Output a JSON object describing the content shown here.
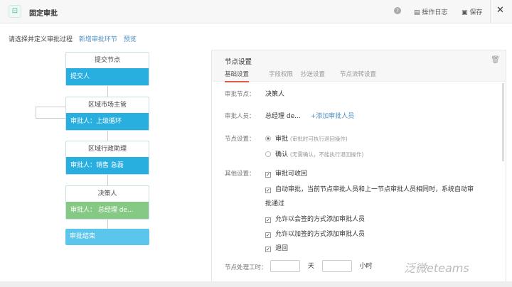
{
  "header": {
    "title": "固定审批",
    "help_icon": "question-icon",
    "log_label": "操作日志",
    "save_label": "保存"
  },
  "intro": {
    "text": "请选择并定义审批过程",
    "add_link": "新增审批环节",
    "preview_link": "预览"
  },
  "flow": {
    "nodes": [
      {
        "title": "提交节点",
        "body": "提交人",
        "color": "#29aee0"
      },
      {
        "title": "区域市场主管",
        "body": "审批人：上级循环",
        "color": "#29aee0"
      },
      {
        "title": "区域行政助理",
        "body": "审批人：销售 急磊",
        "color": "#29aee0"
      },
      {
        "title": "决策人",
        "body": "审批人： 总经理 de...",
        "color": "#86c985"
      }
    ],
    "end": "审批结束"
  },
  "panel": {
    "title": "节点设置",
    "tabs": [
      "基础设置",
      "字段权限",
      "抄送设置",
      "节点流转设置"
    ],
    "node_label": "审批节点：",
    "node_value": "决策人",
    "approver_label": "审批人员：",
    "approver_value": "总经理 de...",
    "add_approver": "+添加审批人员",
    "setting_label": "节点设置：",
    "options": [
      {
        "label": "审批",
        "note": "(审批时可执行退回操作)",
        "selected": true
      },
      {
        "label": "确认",
        "note": "(无需确认，不能执行退回操作)",
        "selected": false
      }
    ],
    "other_label": "其他设置：",
    "checks": [
      {
        "label": "审批可收回",
        "checked": true
      },
      {
        "label": "自动审批，当前节点审批人员和上一节点审批人员相同时，系统自动审",
        "cont": "批通过",
        "checked": true
      },
      {
        "label": "允许以会签的方式添加审批人员",
        "checked": true
      },
      {
        "label": "允许以加签的方式添加审批人员",
        "checked": true
      },
      {
        "label": "退回",
        "checked": true
      }
    ],
    "time_label": "节点处理工时：",
    "day_unit": "天",
    "hour_unit": "小时",
    "days": "",
    "hours": ""
  },
  "watermark": "泛微eteams"
}
